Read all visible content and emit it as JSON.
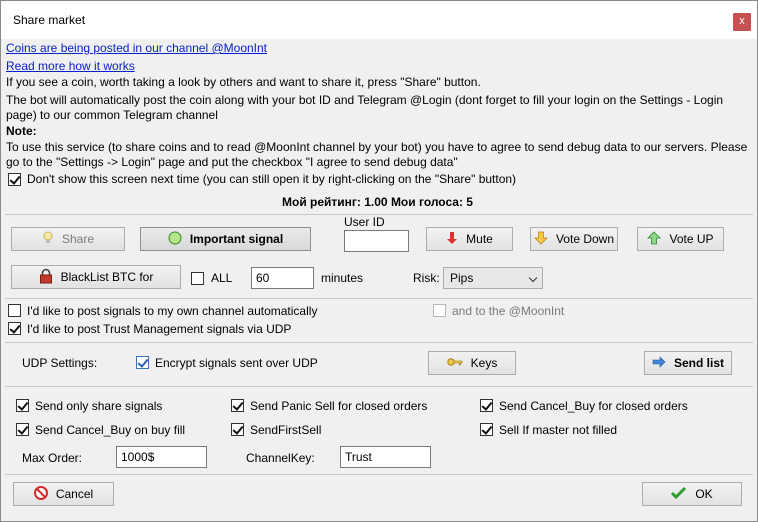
{
  "window": {
    "title": "Share market",
    "close_glyph": "x"
  },
  "info": {
    "link_channel": "Coins are being posted in our channel @MoonInt",
    "link_read_more": "Read more how it works",
    "line1": "If you see a coin, worth taking a look by others and want to share it, press \"Share\" button.",
    "line2": "The bot will automatically post the coin along with your bot ID and Telegram @Login (dont forget to fill your login on the Settings - Login",
    "line3": "page) to our common Telegram channel",
    "note_label": "Note:",
    "note1": "To use this service (to share coins and to read @MoonInt channel by your bot) you have to agree to send debug data to our servers. Please",
    "note2": "go to the \"Settings -> Login\" page and put the checkbox \"I agree to send debug data\"",
    "dont_show_label": "Don't show this screen next time (you can still open it by right-clicking on the \"Share\" button)",
    "dont_show_checked": true,
    "rating": "Мой рейтинг: 1.00  Мои голоса: 5"
  },
  "actions": {
    "share_label": "Share",
    "important_label": "Important signal",
    "user_id_label": "User ID",
    "user_id_value": "",
    "mute_label": "Mute",
    "vote_down_label": "Vote Down",
    "vote_up_label": "Vote UP",
    "blacklist_label": "BlackList BTC for",
    "all_label": "ALL",
    "all_checked": false,
    "minutes_value": "60",
    "minutes_label": "minutes",
    "risk_label": "Risk:",
    "risk_value": "Pips"
  },
  "channel": {
    "own_channel_label": "I'd like to post signals to my own channel automatically",
    "own_channel_checked": false,
    "moonint_label": "and to the @MoonInt",
    "moonint_checked": false,
    "trust_label": "I'd like to post Trust Management signals via UDP",
    "trust_checked": true
  },
  "udp": {
    "settings_label": "UDP Settings:",
    "encrypt_label": "Encrypt signals sent over UDP",
    "encrypt_checked": true,
    "keys_label": "Keys",
    "send_list_label": "Send list",
    "opt_share_only": "Send only share signals",
    "opt_panic_sell": "Send Panic Sell for closed orders",
    "opt_cancel_buy_closed": "Send Cancel_Buy for closed orders",
    "opt_cancel_buy_fill": "Send Cancel_Buy on buy fill",
    "opt_first_sell": "SendFirstSell",
    "opt_sell_if_master": "Sell If master not filled",
    "max_order_label": "Max Order:",
    "max_order_value": "1000$",
    "channel_key_label": "ChannelKey:",
    "channel_key_value": "Trust"
  },
  "footer": {
    "cancel_label": "Cancel",
    "ok_label": "OK"
  },
  "colors": {
    "link": "#0b21c8",
    "close": "#c75050",
    "ok_check": "#2e9c2e",
    "cancel_icon": "#d42a2a"
  }
}
